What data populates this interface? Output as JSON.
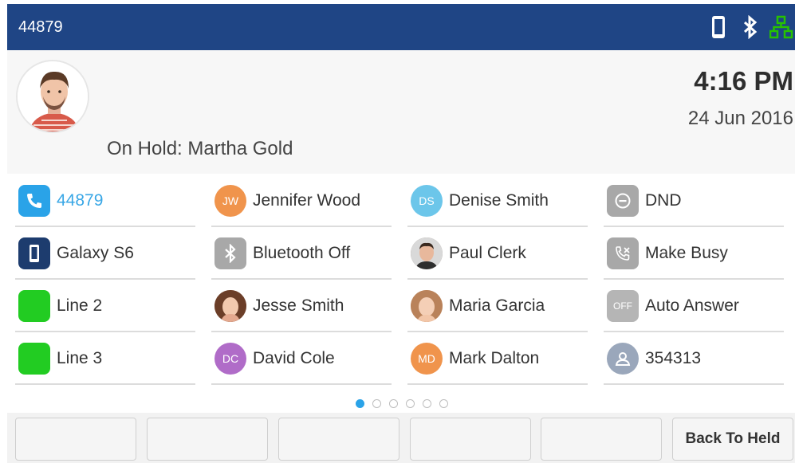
{
  "header": {
    "extension": "44879",
    "status_icons": [
      "mobile-phone-icon",
      "bluetooth-icon",
      "network-icon"
    ],
    "network_color": "#27c200"
  },
  "hero": {
    "hold_text": "On Hold: Martha Gold",
    "time": "4:16 PM",
    "date": "24 Jun 2016"
  },
  "keys": {
    "col1": [
      {
        "label": "44879",
        "icon": "handset-icon",
        "color": "#2aa3e8"
      },
      {
        "label": "Galaxy S6",
        "icon": "mobile-phone-icon",
        "color": "#1d3c6e"
      },
      {
        "label": "Line 2",
        "icon": "line-status-icon",
        "color": "#22cc22"
      },
      {
        "label": "Line 3",
        "icon": "line-status-icon",
        "color": "#22cc22"
      }
    ],
    "col2": [
      {
        "label": "Jennifer Wood",
        "initials": "JW",
        "color": "#f0944c"
      },
      {
        "label": "Bluetooth Off",
        "icon": "bluetooth-icon",
        "color": "#a8a8a8"
      },
      {
        "label": "Jesse Smith",
        "icon": "photo-avatar",
        "color": "#b07a5c"
      },
      {
        "label": "David Cole",
        "initials": "DC",
        "color": "#b06cc8"
      }
    ],
    "col3": [
      {
        "label": "Denise Smith",
        "initials": "DS",
        "color": "#6cc6ea"
      },
      {
        "label": "Paul Clerk",
        "icon": "photo-avatar",
        "color": "#8a7a70"
      },
      {
        "label": "Maria Garcia",
        "icon": "photo-avatar",
        "color": "#d8a070"
      },
      {
        "label": "Mark Dalton",
        "initials": "MD",
        "color": "#f0944c"
      }
    ],
    "col4": [
      {
        "label": "DND",
        "icon": "dnd-icon",
        "color": "#a8a8a8"
      },
      {
        "label": "Make Busy",
        "icon": "make-busy-icon",
        "color": "#a8a8a8"
      },
      {
        "label": "Auto Answer",
        "initials": "OFF",
        "color": "#b5b5b5"
      },
      {
        "label": "354313",
        "icon": "contact-icon",
        "color": "#9aa7bb"
      }
    ]
  },
  "pager": {
    "pages": 6,
    "current": 1
  },
  "softkeys": [
    "",
    "",
    "",
    "",
    "",
    "Back To Held"
  ]
}
